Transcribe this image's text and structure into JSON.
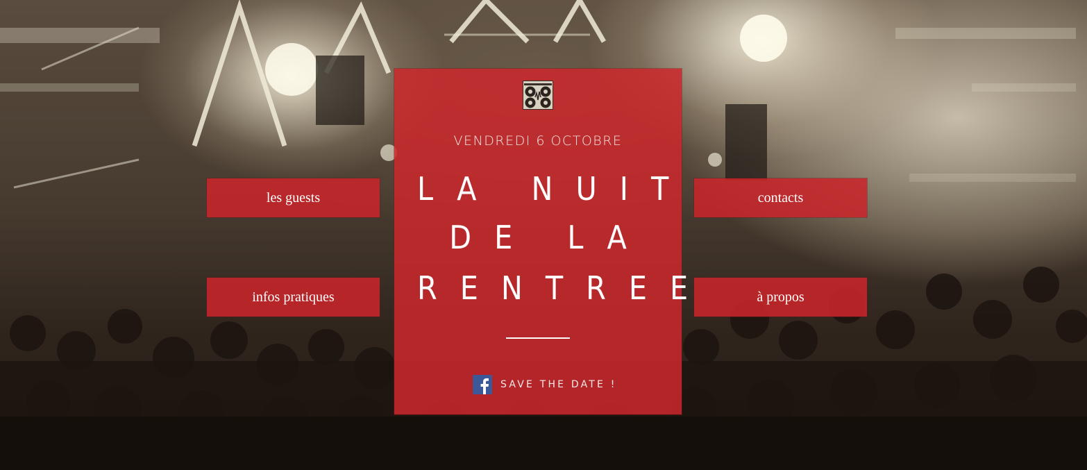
{
  "event": {
    "date": "VENDREDI 6 OCTOBRE",
    "title_lines": [
      "LA NUIT",
      "DE LA",
      "RENTREE"
    ],
    "save_label": "SAVE THE DATE !"
  },
  "nav": {
    "guests": "les guests",
    "contacts": "contacts",
    "infos": "infos pratiques",
    "about": "à propos"
  },
  "icons": {
    "logo": "turntables-logo-icon",
    "facebook": "facebook-icon"
  },
  "colors": {
    "panel": "#cc282c",
    "button": "#c8262a",
    "facebook": "#3b5998"
  }
}
